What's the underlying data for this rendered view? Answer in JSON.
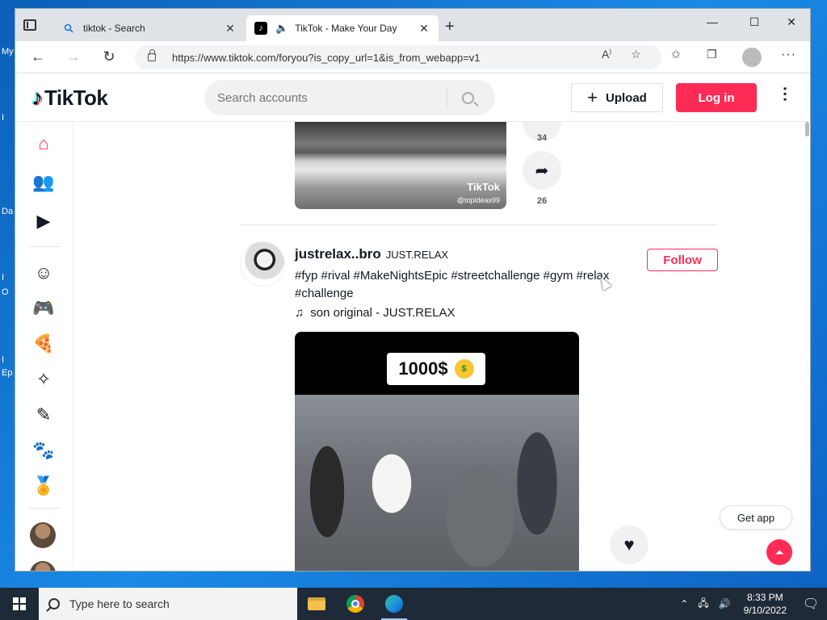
{
  "desktop": {
    "labels": [
      "My",
      "I",
      "Da",
      "I",
      "O",
      "I",
      "Ep"
    ]
  },
  "browser": {
    "tabs": [
      {
        "title": "tiktok - Search",
        "close": "✕"
      },
      {
        "title": "TikTok - Make Your Day",
        "close": "✕"
      }
    ],
    "new_tab": "+",
    "window_controls": {
      "minimize": "—",
      "maximize": "☐",
      "close": "✕"
    },
    "url": "https://www.tiktok.com/foryou?is_copy_url=1&is_from_webapp=v1",
    "nav": {
      "back": "←",
      "forward": "→",
      "refresh": "↻"
    },
    "toolbar_icons": [
      "read-aloud-icon",
      "add-favorite-icon",
      "favorites-icon",
      "collections-icon",
      "profile-icon",
      "more-icon"
    ]
  },
  "tiktok": {
    "logo_text": "TikTok",
    "search_placeholder": "Search accounts",
    "upload_label": "Upload",
    "login_label": "Log in",
    "sidebar_icons": [
      "home-icon",
      "following-icon",
      "live-icon",
      "comedy-icon",
      "gaming-icon",
      "food-icon",
      "dance-icon",
      "beauty-icon",
      "animals-icon",
      "sports-icon"
    ],
    "previous_post": {
      "comment_count": "34",
      "share_count": "26",
      "watermark": "TikTok",
      "watermark_user": "@topideas99"
    },
    "post": {
      "author_name": "justrelax..bro",
      "author_nickname": "JUST.RELAX",
      "follow_label": "Follow",
      "caption": "#fyp #rival #MakeNightsEpic #streetchallenge #gym #relax #challenge",
      "music": "son original - JUST.RELAX",
      "video_overlay_text": "1000$"
    },
    "get_app_label": "Get app"
  },
  "taskbar": {
    "search_placeholder": "Type here to search",
    "time": "8:33 PM",
    "date": "9/10/2022"
  }
}
